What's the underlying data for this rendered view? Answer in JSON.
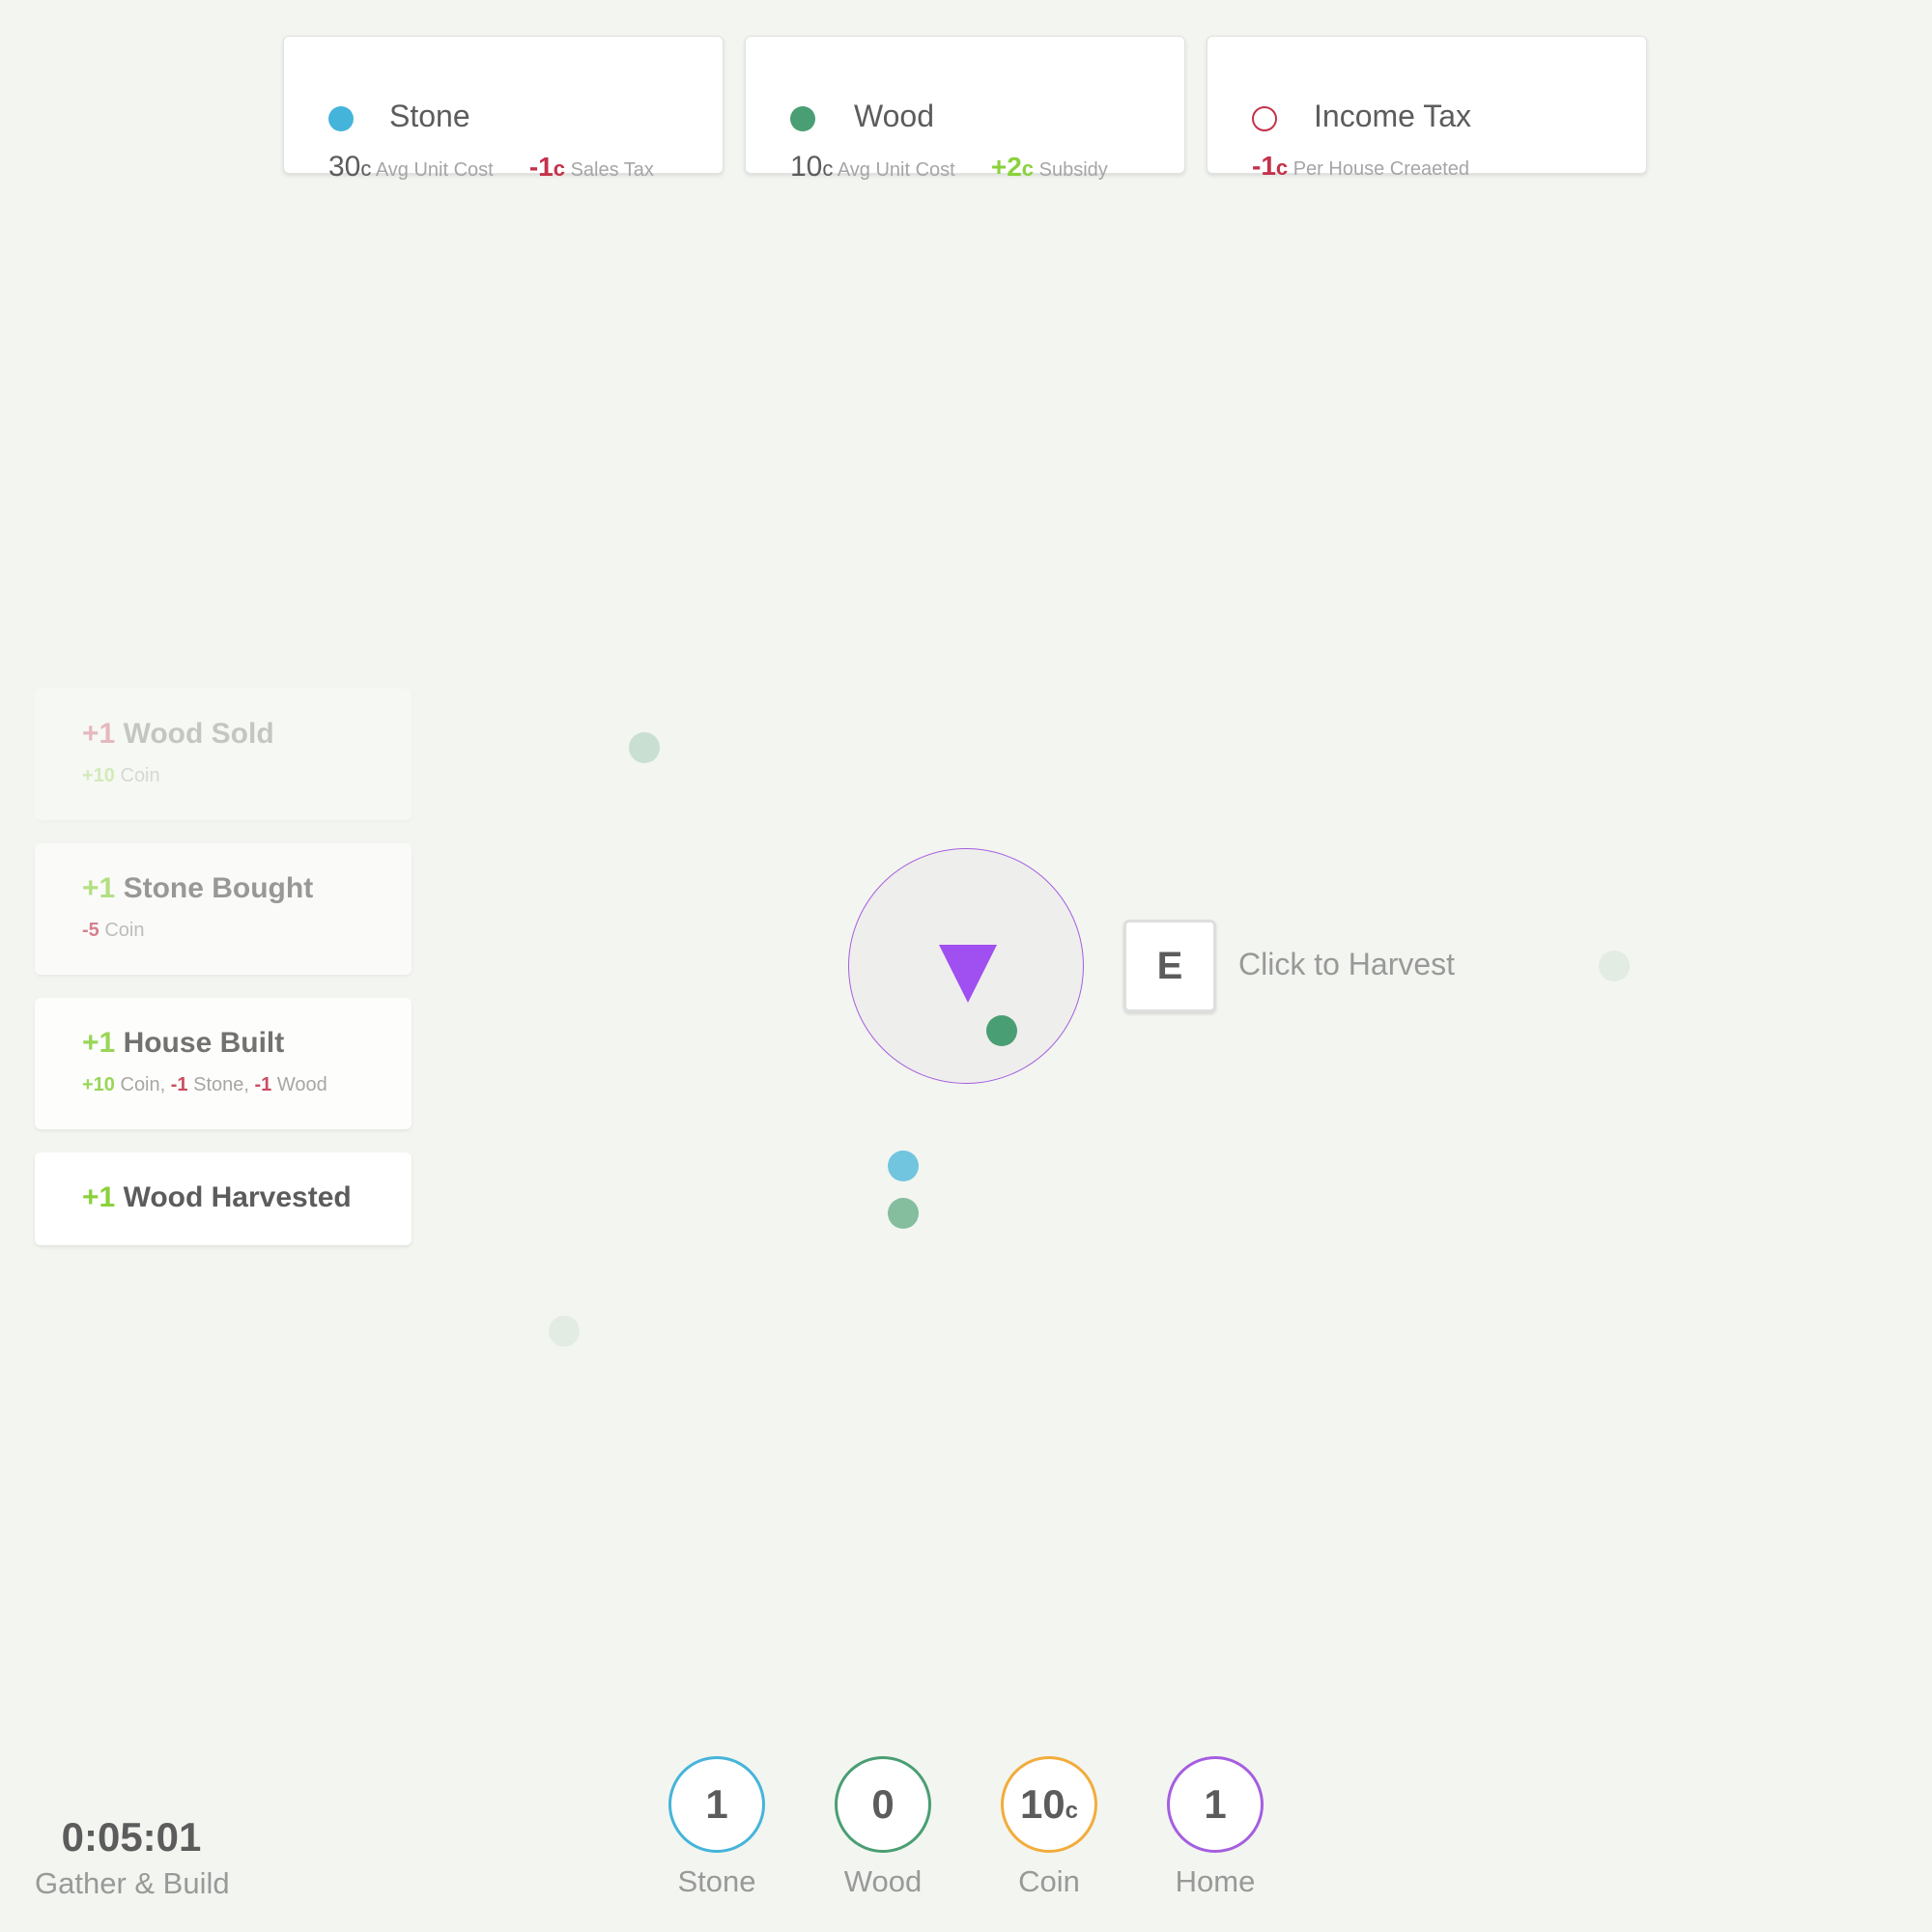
{
  "market": {
    "stone": {
      "name": "Stone",
      "value": "30",
      "unit": "c",
      "desc": "Avg Unit Cost",
      "mod": "-1",
      "mod_unit": "c",
      "mod_desc": "Sales Tax",
      "color": "#45b4da"
    },
    "wood": {
      "name": "Wood",
      "value": "10",
      "unit": "c",
      "desc": "Avg Unit Cost",
      "mod": "+2",
      "mod_unit": "c",
      "mod_desc": "Subsidy",
      "color": "#4a9e73"
    },
    "tax": {
      "name": "Income Tax",
      "mod": "-1",
      "mod_unit": "c",
      "mod_desc": "Per House Creaeted",
      "color": "#c4324a"
    }
  },
  "log": [
    {
      "delta": "+1",
      "label": "Wood Sold",
      "sub": [
        {
          "v": "+10",
          "t": " Coin"
        }
      ]
    },
    {
      "delta": "+1",
      "label": "Stone Bought",
      "sub": [
        {
          "v": "-5",
          "t": " Coin"
        }
      ]
    },
    {
      "delta": "+1",
      "label": "House Built",
      "sub": [
        {
          "v": "+10",
          "t": " Coin, "
        },
        {
          "v": "-1",
          "t": " Stone, "
        },
        {
          "v": "-1",
          "t": " Wood"
        }
      ]
    },
    {
      "delta": "+1",
      "label": "Wood Harvested"
    }
  ],
  "prompt": {
    "key": "E",
    "text": "Click to Harvest"
  },
  "timer": {
    "time": "0:05:01",
    "mode": "Gather & Build"
  },
  "inventory": [
    {
      "label": "Stone",
      "value": "1",
      "unit": "",
      "color": "#45b4da"
    },
    {
      "label": "Wood",
      "value": "0",
      "unit": "",
      "color": "#4a9e73"
    },
    {
      "label": "Coin",
      "value": "10",
      "unit": "c",
      "color": "#f2ac3c"
    },
    {
      "label": "Home",
      "value": "1",
      "unit": "",
      "color": "#a55ee0"
    }
  ],
  "colors": {
    "player": "#a04ff0",
    "positive": "#8ad13c",
    "negative": "#c4324a"
  }
}
